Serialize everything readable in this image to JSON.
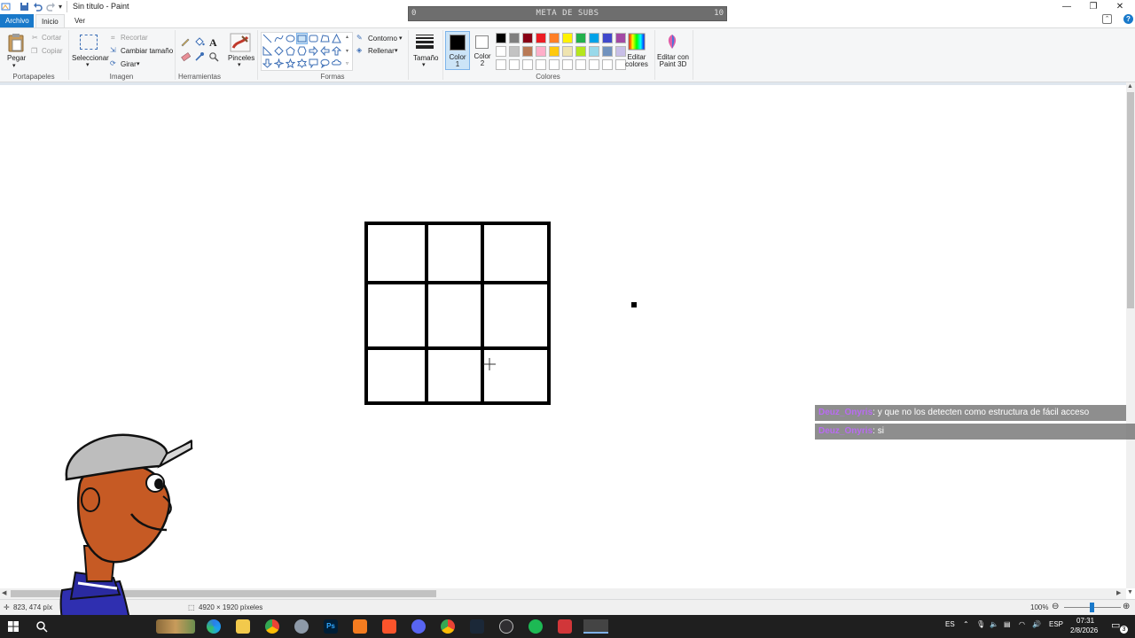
{
  "window": {
    "title": "Sin título - Paint",
    "minimize": "—",
    "maximize": "❐",
    "close": "✕",
    "help": "?"
  },
  "tabs": {
    "file": "Archivo",
    "home": "Inicio",
    "view": "Ver"
  },
  "ribbon": {
    "clipboard": {
      "paste": "Pegar",
      "cut": "Cortar",
      "copy": "Copiar",
      "group": "Portapapeles"
    },
    "image": {
      "select": "Seleccionar",
      "crop": "Recortar",
      "resize": "Cambiar tamaño",
      "rotate": "Girar",
      "group": "Imagen"
    },
    "tools": {
      "group": "Herramientas",
      "text_tool": "A"
    },
    "brushes": {
      "label": "Pinceles"
    },
    "shapes": {
      "outline": "Contorno",
      "fill": "Rellenar",
      "group": "Formas"
    },
    "size": {
      "label": "Tamaño"
    },
    "colors": {
      "color1": "Color 1",
      "color1_value": "#000000",
      "color2": "Color 2",
      "color2_value": "#ffffff",
      "edit_colors": "Editar colores",
      "edit_paint3d": "Editar con Paint 3D",
      "group": "Colores",
      "palette_row1": [
        "#000000",
        "#7f7f7f",
        "#880015",
        "#ed1c24",
        "#ff7f27",
        "#fff200",
        "#22b14c",
        "#00a2e8",
        "#3f48cc",
        "#a349a4"
      ],
      "palette_row2": [
        "#ffffff",
        "#c3c3c3",
        "#b97a57",
        "#ffaec9",
        "#ffc90e",
        "#efe4b0",
        "#b5e61d",
        "#99d9ea",
        "#7092be",
        "#c8bfe7"
      ],
      "palette_row3": [
        "#ffffff",
        "#ffffff",
        "#ffffff",
        "#ffffff",
        "#ffffff",
        "#ffffff",
        "#ffffff",
        "#ffffff",
        "#ffffff",
        "#ffffff"
      ]
    }
  },
  "overlay": {
    "meta_label": "META DE SUBS",
    "meta_min": "0",
    "meta_max": "10",
    "meta_progress": 0
  },
  "chat": [
    {
      "user": "Deuz_Onyris",
      "message": ": y que no los detecten como estructura de fácil acceso"
    },
    {
      "user": "Deuz_Onyris",
      "message": ": si"
    }
  ],
  "status": {
    "cursor_pos": "823, 474 píx",
    "canvas_size": "4920 × 1920 píxeles",
    "zoom": "100%"
  },
  "taskbar": {
    "lang_short": "ES",
    "lang": "ESP",
    "time": "07:31",
    "date": "2/8/2026",
    "notif_count": "3"
  },
  "accent_color": "#1979ca"
}
